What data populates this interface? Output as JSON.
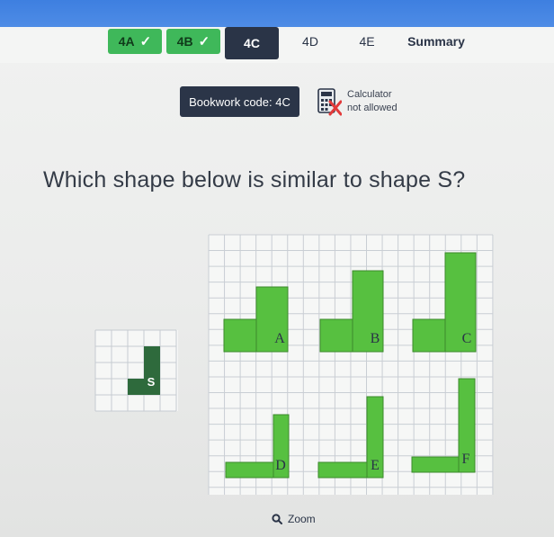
{
  "tabs": [
    {
      "label": "4A",
      "status": "done",
      "check": "✓"
    },
    {
      "label": "4B",
      "status": "done",
      "check": "✓"
    },
    {
      "label": "4C",
      "status": "active"
    },
    {
      "label": "4D",
      "status": "plain"
    },
    {
      "label": "4E",
      "status": "plain"
    },
    {
      "label": "Summary",
      "status": "summary"
    }
  ],
  "bookwork": {
    "label": "Bookwork code: 4C"
  },
  "calculator": {
    "line1": "Calculator",
    "line2": "not allowed",
    "icon": "calculator-crossed-icon"
  },
  "question": {
    "text": "Which shape below is similar to shape S?"
  },
  "shapes": {
    "S": "S",
    "A": "A",
    "B": "B",
    "C": "C",
    "D": "D",
    "E": "E",
    "F": "F"
  },
  "zoom": {
    "label": "Zoom",
    "icon": "magnifier-icon"
  },
  "colors": {
    "done_tab": "#3fb85a",
    "active_tab": "#2b3548",
    "shape_s": "#2e6a3c",
    "shape_green": "#57c040",
    "topbar": "#3e7fe0"
  }
}
